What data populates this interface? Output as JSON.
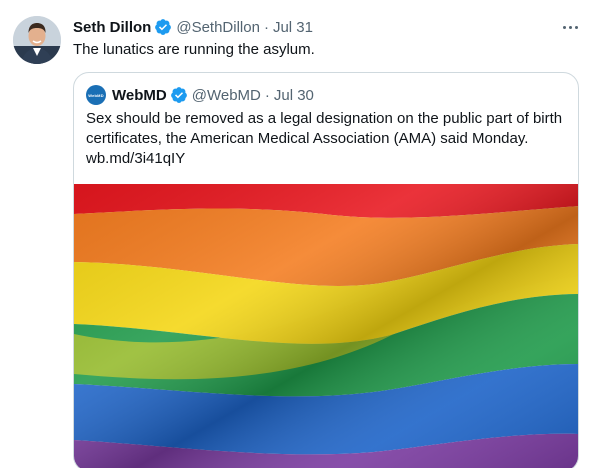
{
  "tweet": {
    "author": {
      "name": "Seth Dillon",
      "handle": "@SethDillon",
      "separator": "·",
      "date": "Jul 31",
      "verified": true
    },
    "text": "The lunatics are running the asylum.",
    "more_icon": "ellipsis-icon",
    "quoted": {
      "author": {
        "name": "WebMD",
        "handle": "@WebMD",
        "separator": "·",
        "date": "Jul 30",
        "verified": true,
        "avatar_text": "WebMD"
      },
      "text": "Sex should be removed as a legal designation on the public part of birth certificates, the American Medical Association (AMA) said Monday. wb.md/3i41qIY",
      "image": {
        "description_icon": "rainbow-flag-image",
        "stripe_colors": [
          "#e8171f",
          "#f47c1f",
          "#f4d613",
          "#1f9a4a",
          "#1e64c8",
          "#7a3ba0"
        ]
      }
    },
    "colors": {
      "verified_blue": "#1d9bf0",
      "secondary_text": "#536471",
      "border": "#cfd9de"
    }
  }
}
